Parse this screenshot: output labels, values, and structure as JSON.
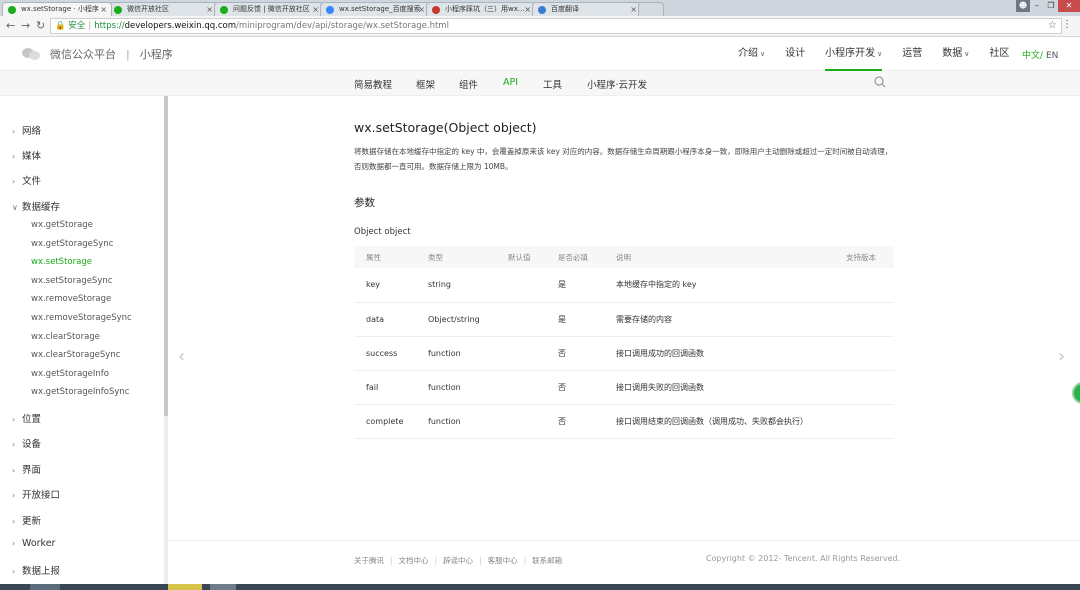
{
  "browser": {
    "tabs": [
      {
        "label": "wx.setStorage · 小程序",
        "active": true,
        "icon": "wechat-icon",
        "color": "#1aad19"
      },
      {
        "label": "微信开放社区",
        "active": false,
        "icon": "wechat-icon",
        "color": "#1aad19"
      },
      {
        "label": "问题反馈 | 微信开放社区",
        "active": false,
        "icon": "wechat-icon",
        "color": "#1aad19"
      },
      {
        "label": "wx.setStorage_百度搜索",
        "active": false,
        "icon": "baidu-icon",
        "color": "#3388ff"
      },
      {
        "label": "小程序踩坑（三）用wx...",
        "active": false,
        "icon": "csdn-icon",
        "color": "#c8372d"
      },
      {
        "label": "百度翻译",
        "active": false,
        "icon": "fanyi-icon",
        "color": "#3a7bd5"
      }
    ],
    "close_glyph": "×",
    "address": {
      "secure_label": "安全",
      "scheme": "https://",
      "host": "developers.weixin.qq.com",
      "path": "/miniprogram/dev/api/storage/wx.setStorage.html"
    }
  },
  "site": {
    "brand": "微信公众平台",
    "divider": "|",
    "product": "小程序",
    "topnav": [
      {
        "label": "介绍",
        "dropdown": true,
        "active": false
      },
      {
        "label": "设计",
        "dropdown": false,
        "active": false
      },
      {
        "label": "小程序开发",
        "dropdown": true,
        "active": true
      },
      {
        "label": "运营",
        "dropdown": false,
        "active": false
      },
      {
        "label": "数据",
        "dropdown": true,
        "active": false
      },
      {
        "label": "社区",
        "dropdown": false,
        "active": false
      }
    ],
    "lang_zh": "中文",
    "lang_sep": "/",
    "lang_en": "EN",
    "accent_color": "#1aad19"
  },
  "subnav": [
    {
      "label": "简易教程",
      "active": false
    },
    {
      "label": "框架",
      "active": false
    },
    {
      "label": "组件",
      "active": false
    },
    {
      "label": "API",
      "active": true
    },
    {
      "label": "工具",
      "active": false
    },
    {
      "label": "小程序·云开发",
      "active": false
    }
  ],
  "sidebar": {
    "categories_top": [
      {
        "label": "网络",
        "expanded": false
      },
      {
        "label": "媒体",
        "expanded": false
      },
      {
        "label": "文件",
        "expanded": false
      },
      {
        "label": "数据缓存",
        "expanded": true
      }
    ],
    "items": [
      {
        "label": "wx.getStorage",
        "active": false
      },
      {
        "label": "wx.getStorageSync",
        "active": false
      },
      {
        "label": "wx.setStorage",
        "active": true
      },
      {
        "label": "wx.setStorageSync",
        "active": false
      },
      {
        "label": "wx.removeStorage",
        "active": false
      },
      {
        "label": "wx.removeStorageSync",
        "active": false
      },
      {
        "label": "wx.clearStorage",
        "active": false
      },
      {
        "label": "wx.clearStorageSync",
        "active": false
      },
      {
        "label": "wx.getStorageInfo",
        "active": false
      },
      {
        "label": "wx.getStorageInfoSync",
        "active": false
      }
    ],
    "categories_bottom": [
      {
        "label": "位置"
      },
      {
        "label": "设备"
      },
      {
        "label": "界面"
      },
      {
        "label": "开放接口"
      },
      {
        "label": "更新"
      },
      {
        "label": "Worker"
      },
      {
        "label": "数据上报"
      }
    ]
  },
  "content": {
    "title": "wx.setStorage(Object object)",
    "description": "将数据存储在本地缓存中指定的 key 中，会覆盖掉原来该 key 对应的内容。数据存储生命周期跟小程序本身一致，即除用户主动删除或超过一定时间被自动清理，否则数据都一直可用。数据存储上限为 10MB。",
    "params_heading": "参数",
    "object_label": "Object object",
    "table": {
      "headers": [
        "属性",
        "类型",
        "默认值",
        "是否必填",
        "说明",
        "支持版本"
      ],
      "rows": [
        [
          "key",
          "string",
          "",
          "是",
          "本地缓存中指定的 key",
          ""
        ],
        [
          "data",
          "Object/string",
          "",
          "是",
          "需要存储的内容",
          ""
        ],
        [
          "success",
          "function",
          "",
          "否",
          "接口调用成功的回调函数",
          ""
        ],
        [
          "fail",
          "function",
          "",
          "否",
          "接口调用失败的回调函数",
          ""
        ],
        [
          "complete",
          "function",
          "",
          "否",
          "接口调用结束的回调函数（调用成功、失败都会执行）",
          ""
        ]
      ]
    }
  },
  "footer": {
    "links": [
      "关于腾讯",
      "文档中心",
      "辟谣中心",
      "客服中心",
      "联系邮箱"
    ],
    "copyright": "Copyright © 2012- Tencent. All Rights Reserved."
  }
}
